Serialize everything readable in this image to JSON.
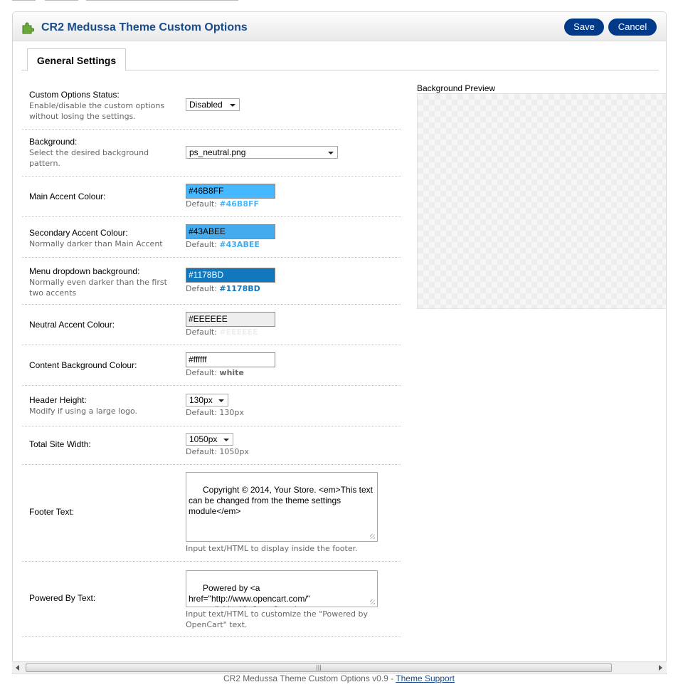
{
  "header": {
    "title": "CR2 Medussa Theme Custom Options",
    "save_label": "Save",
    "cancel_label": "Cancel"
  },
  "tabs": [
    {
      "label": "General Settings",
      "active": true
    }
  ],
  "settings": {
    "status": {
      "label": "Custom Options Status:",
      "help": "Enable/disable the custom options without losing the settings.",
      "value": "Disabled"
    },
    "background": {
      "label": "Background:",
      "help": "Select the desired background pattern.",
      "value": "ps_neutral.png"
    },
    "main_accent": {
      "label": "Main Accent Colour:",
      "value": "#46B8FF",
      "default_prefix": "Default:",
      "default_value": "#46B8FF",
      "color": "#46B8FF"
    },
    "secondary_accent": {
      "label": "Secondary Accent Colour:",
      "help": "Normally darker than Main Accent",
      "value": "#43ABEE",
      "default_prefix": "Default:",
      "default_value": "#43ABEE",
      "color": "#43ABEE"
    },
    "menu_dropdown": {
      "label": "Menu dropdown background:",
      "help": "Normally even darker than the first two accents",
      "value": "#1178BD",
      "default_prefix": "Default:",
      "default_value": "#1178BD",
      "color": "#1178BD"
    },
    "neutral_accent": {
      "label": "Neutral Accent Colour:",
      "value": "#EEEEEE",
      "default_prefix": "Default:",
      "default_value": "#EEEEEE",
      "color": "#EEEEEE"
    },
    "content_bg": {
      "label": "Content Background Colour:",
      "value": "#ffffff",
      "default_prefix": "Default:",
      "default_value": "white",
      "color": "#FFFFFF"
    },
    "header_height": {
      "label": "Header Height:",
      "help": "Modify if using a large logo.",
      "value": "130px",
      "default_text": "Default: 130px"
    },
    "site_width": {
      "label": "Total Site Width:",
      "value": "1050px",
      "default_text": "Default: 1050px"
    },
    "footer_text": {
      "label": "Footer Text:",
      "value": "Copyright © 2014, Your Store. <em>This text can be changed from the theme settings module</em>",
      "help": "Input text/HTML to display inside the footer."
    },
    "powered_by": {
      "label": "Powered By Text:",
      "value": "Powered by <a href=\"http://www.opencart.com/\" target=\"_blank\">OpenCart</a>",
      "help": "Input text/HTML to customize the \"Powered by OpenCart\" text."
    }
  },
  "preview": {
    "label": "Background Preview"
  },
  "footer": {
    "text": "CR2 Medussa Theme Custom Options v0.9 - ",
    "link": "Theme Support"
  },
  "colors": {
    "brand": "#1A4C8B",
    "button": "#003A88"
  },
  "icons": {
    "heading": "puzzle-piece-icon"
  }
}
